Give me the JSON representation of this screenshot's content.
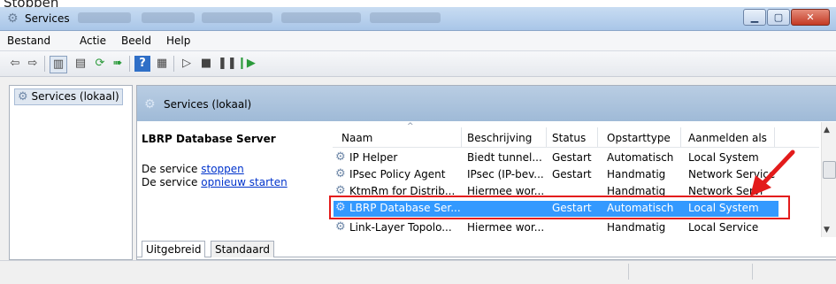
{
  "caption": "Stoppen",
  "window": {
    "title": "Services"
  },
  "menu": [
    "Bestand",
    "Actie",
    "Beeld",
    "Help"
  ],
  "tree": {
    "item": "Services (lokaal)"
  },
  "panel": {
    "header": "Services (lokaal)",
    "selected_service": "LBRP Database Server",
    "action_prefix_1": "De service ",
    "action_link_1": "stoppen",
    "action_prefix_2": "De service ",
    "action_link_2": "opnieuw starten"
  },
  "columns": [
    "Naam",
    "Beschrijving",
    "Status",
    "Opstarttype",
    "Aanmelden als"
  ],
  "rows": [
    {
      "name": "IP Helper",
      "desc": "Biedt tunnel...",
      "status": "Gestart",
      "startup": "Automatisch",
      "logon": "Local System"
    },
    {
      "name": "IPsec Policy Agent",
      "desc": "IPsec (IP-bev...",
      "status": "Gestart",
      "startup": "Handmatig",
      "logon": "Network Service"
    },
    {
      "name": "KtmRm for Distrib...",
      "desc": "Hiermee wor...",
      "status": "",
      "startup": "Handmatig",
      "logon": "Network Servi"
    },
    {
      "name": "LBRP Database Ser...",
      "desc": "",
      "status": "Gestart",
      "startup": "Automatisch",
      "logon": "Local System"
    },
    {
      "name": "Link-Layer Topolo...",
      "desc": "Hiermee wor...",
      "status": "",
      "startup": "Handmatig",
      "logon": "Local Service"
    }
  ],
  "tabs": [
    "Uitgebreid",
    "Standaard"
  ],
  "colors": {
    "selection": "#3399ff",
    "highlight_box": "#e31b1b",
    "header_gradient": "#b9cde3"
  }
}
